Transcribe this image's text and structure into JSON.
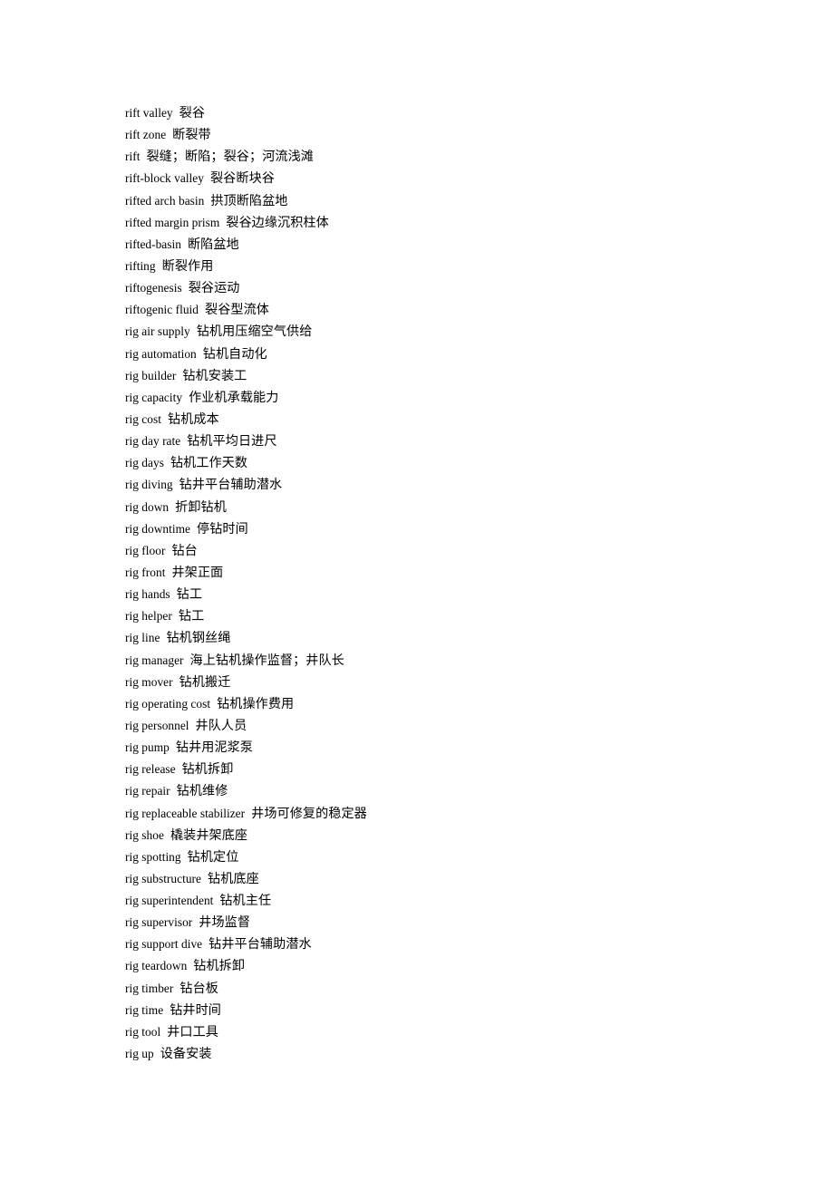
{
  "document": {
    "type": "bilingual-glossary",
    "language_pair": "English-Chinese",
    "entry_count": 43
  },
  "entries": [
    {
      "term": "rift valley",
      "gloss": "裂谷"
    },
    {
      "term": "rift zone",
      "gloss": "断裂带"
    },
    {
      "term": "rift",
      "gloss": "裂缝；断陷；裂谷；河流浅滩"
    },
    {
      "term": "rift-block valley",
      "gloss": "裂谷断块谷"
    },
    {
      "term": "rifted arch basin",
      "gloss": "拱顶断陷盆地"
    },
    {
      "term": "rifted margin prism",
      "gloss": "裂谷边缘沉积柱体"
    },
    {
      "term": "rifted-basin",
      "gloss": "断陷盆地"
    },
    {
      "term": "rifting",
      "gloss": "断裂作用"
    },
    {
      "term": "riftogenesis",
      "gloss": "裂谷运动"
    },
    {
      "term": "riftogenic fluid",
      "gloss": "裂谷型流体"
    },
    {
      "term": "rig air supply",
      "gloss": "钻机用压缩空气供给"
    },
    {
      "term": "rig automation",
      "gloss": "钻机自动化"
    },
    {
      "term": "rig builder",
      "gloss": "钻机安装工"
    },
    {
      "term": "rig capacity",
      "gloss": "作业机承载能力"
    },
    {
      "term": "rig cost",
      "gloss": "钻机成本"
    },
    {
      "term": "rig day rate",
      "gloss": "钻机平均日进尺"
    },
    {
      "term": "rig days",
      "gloss": "钻机工作天数"
    },
    {
      "term": "rig diving",
      "gloss": "钻井平台辅助潜水"
    },
    {
      "term": "rig down",
      "gloss": "折卸钻机"
    },
    {
      "term": "rig downtime",
      "gloss": "停钻时间"
    },
    {
      "term": "rig floor",
      "gloss": "钻台"
    },
    {
      "term": "rig front",
      "gloss": "井架正面"
    },
    {
      "term": "rig hands",
      "gloss": "钻工"
    },
    {
      "term": "rig helper",
      "gloss": "钻工"
    },
    {
      "term": "rig line",
      "gloss": "钻机钢丝绳"
    },
    {
      "term": "rig manager",
      "gloss": "海上钻机操作监督；井队长"
    },
    {
      "term": "rig mover",
      "gloss": "钻机搬迁"
    },
    {
      "term": "rig operating cost",
      "gloss": "钻机操作费用"
    },
    {
      "term": "rig personnel",
      "gloss": "井队人员"
    },
    {
      "term": "rig pump",
      "gloss": "钻井用泥浆泵"
    },
    {
      "term": "rig release",
      "gloss": "钻机拆卸"
    },
    {
      "term": "rig repair",
      "gloss": "钻机维修"
    },
    {
      "term": "rig replaceable stabilizer",
      "gloss": "井场可修复的稳定器"
    },
    {
      "term": "rig shoe",
      "gloss": "橇装井架底座"
    },
    {
      "term": "rig spotting",
      "gloss": "钻机定位"
    },
    {
      "term": "rig substructure",
      "gloss": "钻机底座"
    },
    {
      "term": "rig superintendent",
      "gloss": "钻机主任"
    },
    {
      "term": "rig supervisor",
      "gloss": "井场监督"
    },
    {
      "term": "rig support dive",
      "gloss": "钻井平台辅助潜水"
    },
    {
      "term": "rig teardown",
      "gloss": "钻机拆卸"
    },
    {
      "term": "rig timber",
      "gloss": "钻台板"
    },
    {
      "term": "rig time",
      "gloss": "钻井时间"
    },
    {
      "term": "rig tool",
      "gloss": "井口工具"
    },
    {
      "term": "rig up",
      "gloss": "设备安装"
    }
  ]
}
